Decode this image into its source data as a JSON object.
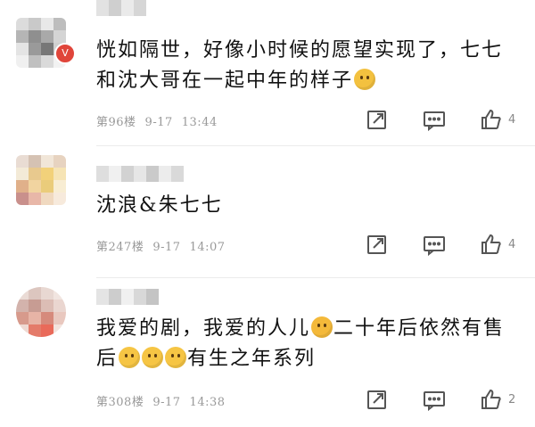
{
  "comments": [
    {
      "text": "恍如隔世，好像小时候的愿望实现了，七七和沈大哥在一起中年的样子",
      "emoji_names": [
        "crying-face-emoji"
      ],
      "floor": "第96楼",
      "date": "9-17",
      "time": "13:44",
      "likes": "4",
      "badge": "V"
    },
    {
      "text": "沈浪&朱七七",
      "floor": "第247楼",
      "date": "9-17",
      "time": "14:07",
      "likes": "4"
    },
    {
      "text_part1": "我爱的剧，我爱的人儿",
      "text_part2": "二十年后依然有售后",
      "text_part3": "有生之年系列",
      "emoji_names": [
        "yum-face-emoji",
        "thinking-face-emoji",
        "thinking-face-emoji",
        "thinking-face-emoji"
      ],
      "floor": "第308楼",
      "date": "9-17",
      "time": "14:38",
      "likes": "2"
    }
  ],
  "icons": {
    "share": "share-icon",
    "comment": "comment-icon",
    "like": "thumbs-up-icon"
  },
  "colors": {
    "meta": "#999999",
    "icon": "#555555",
    "badge": "#e0453a",
    "emoji": "#f6c544"
  }
}
